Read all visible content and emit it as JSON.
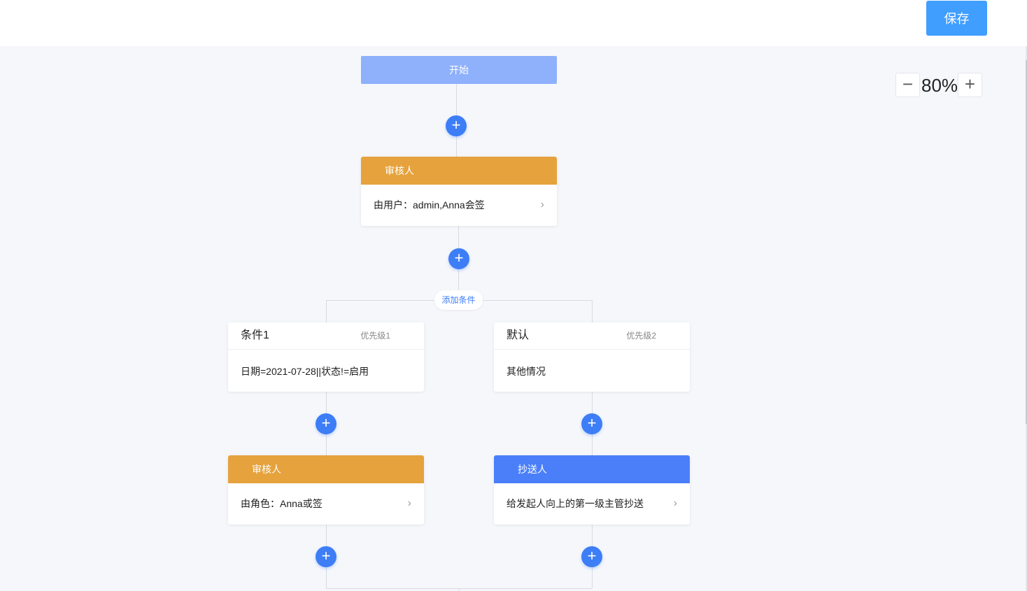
{
  "header": {
    "save_label": "保存"
  },
  "zoom": {
    "minus": "−",
    "value": "80%",
    "plus": "+"
  },
  "flow": {
    "start_label": "开始",
    "add_symbol": "+",
    "approver_main": {
      "title": "审核人",
      "desc": "由用户：admin,Anna会签",
      "arrow": "›"
    },
    "add_condition_label": "添加条件",
    "branches": [
      {
        "title": "条件1",
        "priority": "优先级1",
        "desc": "日期=2021-07-28||状态!=启用",
        "node": {
          "title": "审核人",
          "desc": "由角色：Anna或签",
          "arrow": "›",
          "color": "#e6a23c"
        }
      },
      {
        "title": "默认",
        "priority": "优先级2",
        "desc": "其他情况",
        "node": {
          "title": "抄送人",
          "desc": "给发起人向上的第一级主管抄送",
          "arrow": "›",
          "color": "#4a7ff9"
        }
      }
    ]
  },
  "colors": {
    "accent": "#409eff",
    "start": "#8fb0fb",
    "approver": "#e6a23c",
    "cc": "#4a7ff9",
    "canvas": "#f5f7fb"
  }
}
